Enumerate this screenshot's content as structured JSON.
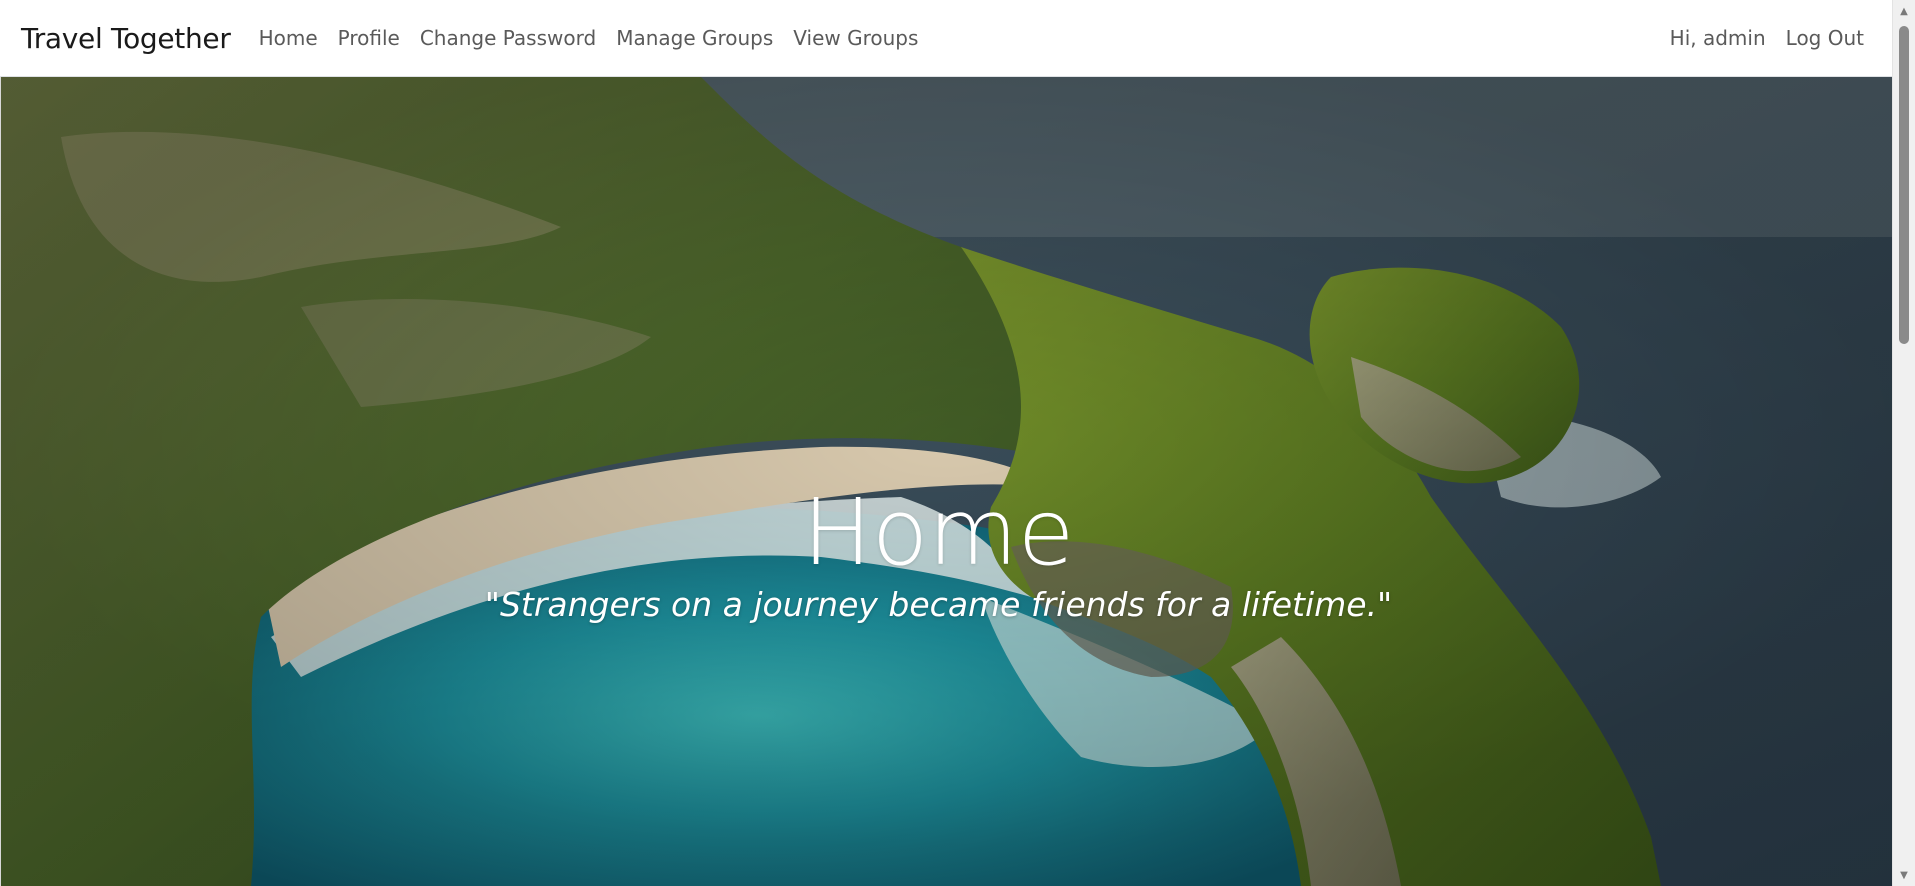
{
  "navbar": {
    "brand": "Travel Together",
    "links": [
      {
        "label": "Home"
      },
      {
        "label": "Profile"
      },
      {
        "label": "Change Password"
      },
      {
        "label": "Manage Groups"
      },
      {
        "label": "View Groups"
      }
    ],
    "greeting": "Hi, admin",
    "logout": "Log Out"
  },
  "hero": {
    "title": "Home",
    "quote": "\"Strangers on a journey became friends for a lifetime.\"",
    "background": "aerial-coastline-cliff-photo"
  },
  "icons": {
    "scroll_up": "chevron-up-icon",
    "scroll_down": "chevron-down-icon"
  }
}
